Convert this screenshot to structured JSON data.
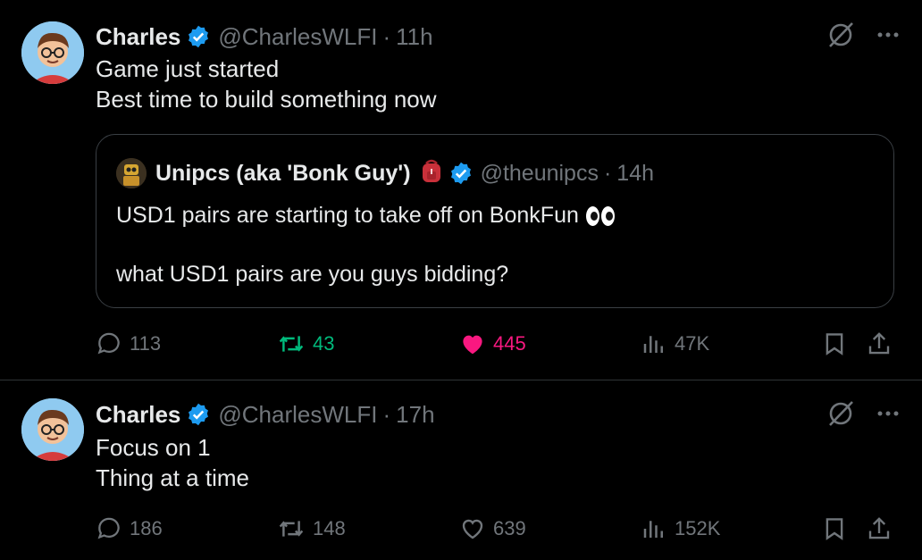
{
  "tweets": [
    {
      "author_name": "Charles",
      "handle": "@CharlesWLFI",
      "time": "11h",
      "lines": [
        "Game just started",
        "Best time to build something now"
      ],
      "quote": {
        "author_name": "Unipcs (aka 'Bonk Guy')",
        "handle": "@theunipcs",
        "time": "14h",
        "line1": "USD1 pairs are starting to take off on BonkFun",
        "line2": "what USD1 pairs are you guys bidding?"
      },
      "stats": {
        "replies": "113",
        "reposts": "43",
        "likes": "445",
        "views": "47K"
      },
      "liked": true,
      "reposted": true
    },
    {
      "author_name": "Charles",
      "handle": "@CharlesWLFI",
      "time": "17h",
      "lines": [
        "Focus on 1",
        "Thing at a time"
      ],
      "stats": {
        "replies": "186",
        "reposts": "148",
        "likes": "639",
        "views": "152K"
      },
      "liked": false,
      "reposted": false
    }
  ],
  "separator": "·",
  "colors": {
    "verified": "#1d9bf0",
    "like": "#f91880",
    "repost": "#00ba7c",
    "muted": "#71767b"
  },
  "icons": [
    "verified-badge-icon",
    "grok-icon",
    "more-icon",
    "reply-icon",
    "repost-icon",
    "like-icon",
    "views-icon",
    "bookmark-icon",
    "share-icon"
  ]
}
